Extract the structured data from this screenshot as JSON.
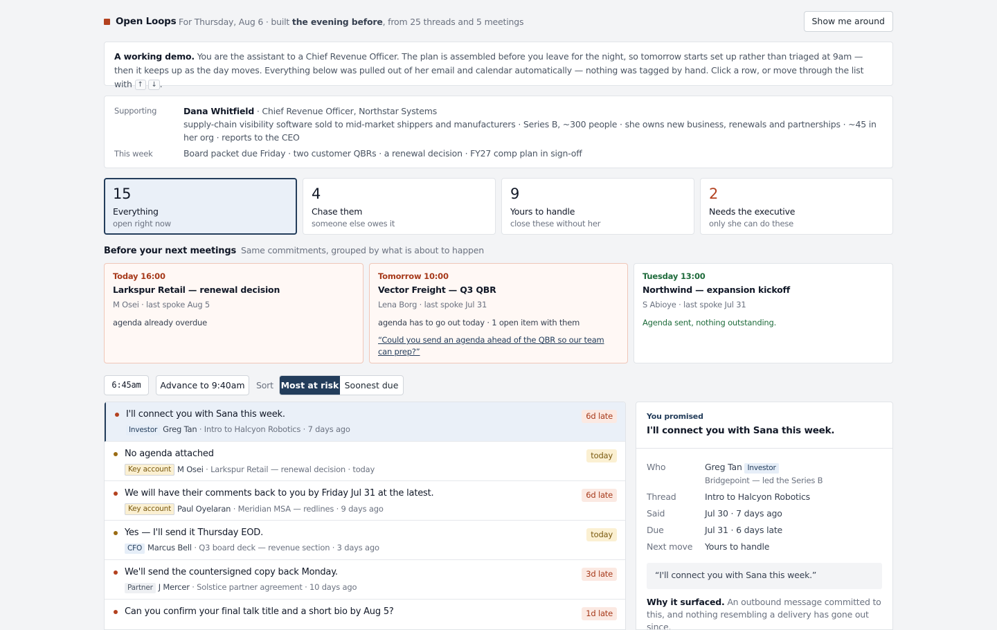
{
  "header": {
    "brand": "Open Loops",
    "sub_prefix": "For Thursday, Aug 6 · built ",
    "sub_bold": "the evening before",
    "sub_suffix": ", from 25 threads and 5 meetings",
    "tour_button": "Show me around"
  },
  "intro": {
    "lead": "A working demo.",
    "text": " You are the assistant to a Chief Revenue Officer. The plan is assembled before you leave for the night, so tomorrow starts set up rather than triaged at 9am — then it keeps up as the day moves. Everything below was pulled out of her email and calendar automatically — nothing was tagged by hand. Click a row, or move through the list with ",
    "key_up": "↑",
    "key_down": "↓",
    "end": "."
  },
  "supporting": {
    "label": "Supporting",
    "name": "Dana Whitfield",
    "role": " · Chief Revenue Officer, Northstar Systems",
    "desc": "supply-chain visibility software sold to mid-market shippers and manufacturers · Series B, ~300 people · she owns new business, renewals and partnerships · ~45 in her org · reports to the CEO",
    "week_label": "This week",
    "week": "Board packet due Friday · two customer QBRs · a renewal decision · FY27 comp plan in sign-off"
  },
  "stats": [
    {
      "num": "15",
      "title": "Everything",
      "sub": "open right now"
    },
    {
      "num": "4",
      "title": "Chase them",
      "sub": "someone else owes it"
    },
    {
      "num": "9",
      "title": "Yours to handle",
      "sub": "close these without her"
    },
    {
      "num": "2",
      "title": "Needs the executive",
      "sub": "only she can do these"
    }
  ],
  "meetings_section": {
    "title": "Before your next meetings",
    "sub": "Same commitments, grouped by what is about to happen"
  },
  "meetings": [
    {
      "time": "Today 16:00",
      "title": "Larkspur Retail — renewal decision",
      "who": "M Osei · last spoke Aug 5",
      "note": "agenda already overdue",
      "link": ""
    },
    {
      "time": "Tomorrow 10:00",
      "title": "Vector Freight — Q3 QBR",
      "who": "Lena Borg · last spoke Jul 31",
      "note": "agenda has to go out today · 1 open item with them",
      "link": "“Could you send an agenda ahead of the QBR so our team can prep?”"
    },
    {
      "time": "Tuesday 13:00",
      "title": "Northwind — expansion kickoff",
      "who": "S Abioye · last spoke Jul 31",
      "note": "Agenda sent, nothing outstanding.",
      "link": ""
    }
  ],
  "controls": {
    "clock": "6:45am",
    "advance": "Advance to 9:40am",
    "sort_label": "Sort",
    "sort_on": "Most at risk",
    "sort_off": "Soonest due"
  },
  "rows": [
    {
      "title": "I'll connect you with Sana this week.",
      "tag": "Investor",
      "who": "Greg Tan",
      "meta": " · Intro to Halcyon Robotics · 7 days ago",
      "badge": "6d late"
    },
    {
      "title": "No agenda attached",
      "tag": "Key account",
      "who": "M Osei",
      "meta": " · Larkspur Retail — renewal decision · today",
      "badge": "today"
    },
    {
      "title": "We will have their comments back to you by Friday Jul 31 at the latest.",
      "tag": "Key account",
      "who": "Paul Oyelaran",
      "meta": " · Meridian MSA — redlines · 9 days ago",
      "badge": "6d late"
    },
    {
      "title": "Yes — I'll send it Thursday EOD.",
      "tag": "CFO",
      "who": "Marcus Bell",
      "meta": " · Q3 board deck — revenue section · 3 days ago",
      "badge": "today"
    },
    {
      "title": "We'll send the countersigned copy back Monday.",
      "tag": "Partner",
      "who": "J Mercer",
      "meta": " · Solstice partner agreement · 10 days ago",
      "badge": "3d late"
    },
    {
      "title": "Can you confirm your final talk title and a short bio by Aug 5?",
      "tag": "",
      "who": "",
      "meta": "",
      "badge": "1d late"
    }
  ],
  "detail": {
    "kicker": "You promised",
    "title": "I'll connect you with Sana this week.",
    "who_label": "Who",
    "who": "Greg Tan",
    "who_tag": "Investor",
    "who_sub": "Bridgepoint — led the Series B",
    "thread_label": "Thread",
    "thread": "Intro to Halcyon Robotics",
    "said_label": "Said",
    "said": "Jul 30 · 7 days ago",
    "due_label": "Due",
    "due": "Jul 31 · 6 days late",
    "next_label": "Next move",
    "next": "Yours to handle",
    "quote": "“I'll connect you with Sana this week.”",
    "why_lead": "Why it surfaced.",
    "why": " An outbound message committed to this, and nothing resembling a delivery has gone out since."
  },
  "colors": {
    "accent": "#233d5b",
    "brand": "#b3411f",
    "late": "#a6391a",
    "today": "#7a5a10",
    "ok": "#1e6b3b"
  }
}
